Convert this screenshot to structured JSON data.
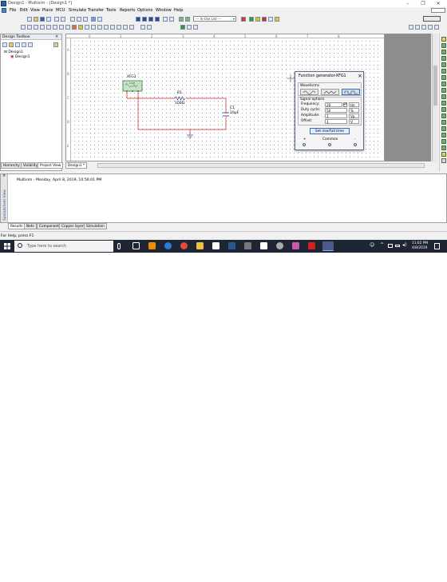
{
  "window": {
    "title": "Design1 - Multisim - [Design1 *]",
    "minimize": "–",
    "maximize": "❐",
    "close": "✕"
  },
  "menu": [
    "File",
    "Edit",
    "View",
    "Place",
    "MCU",
    "Simulate",
    "Transfer",
    "Tools",
    "Reports",
    "Options",
    "Window",
    "Help"
  ],
  "toolbar": {
    "in_use_list": "--- In-Use List ---"
  },
  "toolbox": {
    "title": "Design Toolbox",
    "tree": [
      "Design1",
      "Design1"
    ],
    "tabs": [
      "Hierarchy",
      "Visibility",
      "Project View"
    ]
  },
  "canvas": {
    "ruler_numbers": [
      "0",
      "1",
      "2",
      "3",
      "4",
      "5",
      "6",
      "7",
      "8"
    ],
    "ruler_letters": [
      "A",
      "B",
      "C",
      "D",
      "E"
    ],
    "tab": "Design1 *"
  },
  "schematic": {
    "xfg1": "XFG1",
    "xfg1_terms": [
      "+",
      "COM",
      "-"
    ],
    "r1_name": "R1",
    "r1_value": "100Ω",
    "c1_name": "C1",
    "c1_value": "10µF"
  },
  "dialog": {
    "title": "Function generator-XFG1",
    "close": "×",
    "waveforms_label": "Waveforms",
    "signal_label": "Signal options",
    "rows": [
      {
        "label": "Frequency:",
        "value": "20",
        "unit": "Hz"
      },
      {
        "label": "Duty cycle:",
        "value": "50",
        "unit": "%"
      },
      {
        "label": "Amplitude:",
        "value": "1",
        "unit": "Vp"
      },
      {
        "label": "Offset:",
        "value": "1",
        "unit": "V"
      }
    ],
    "rise_fall": "Set rise/Fall time",
    "plus": "+",
    "common": "Common",
    "minus": "-"
  },
  "output": {
    "message": "Multisim  -  Monday, April 8, 2019, 10:56:01 PM",
    "side_label": "Spreadsheet View",
    "tabs": [
      "Results",
      "Nets",
      "Components",
      "Copper layers",
      "Simulation"
    ]
  },
  "status": {
    "help": "For Help, press F1"
  },
  "taskbar": {
    "search": "Type here to search",
    "time": "11:02 PM",
    "date": "4/8/2019"
  }
}
